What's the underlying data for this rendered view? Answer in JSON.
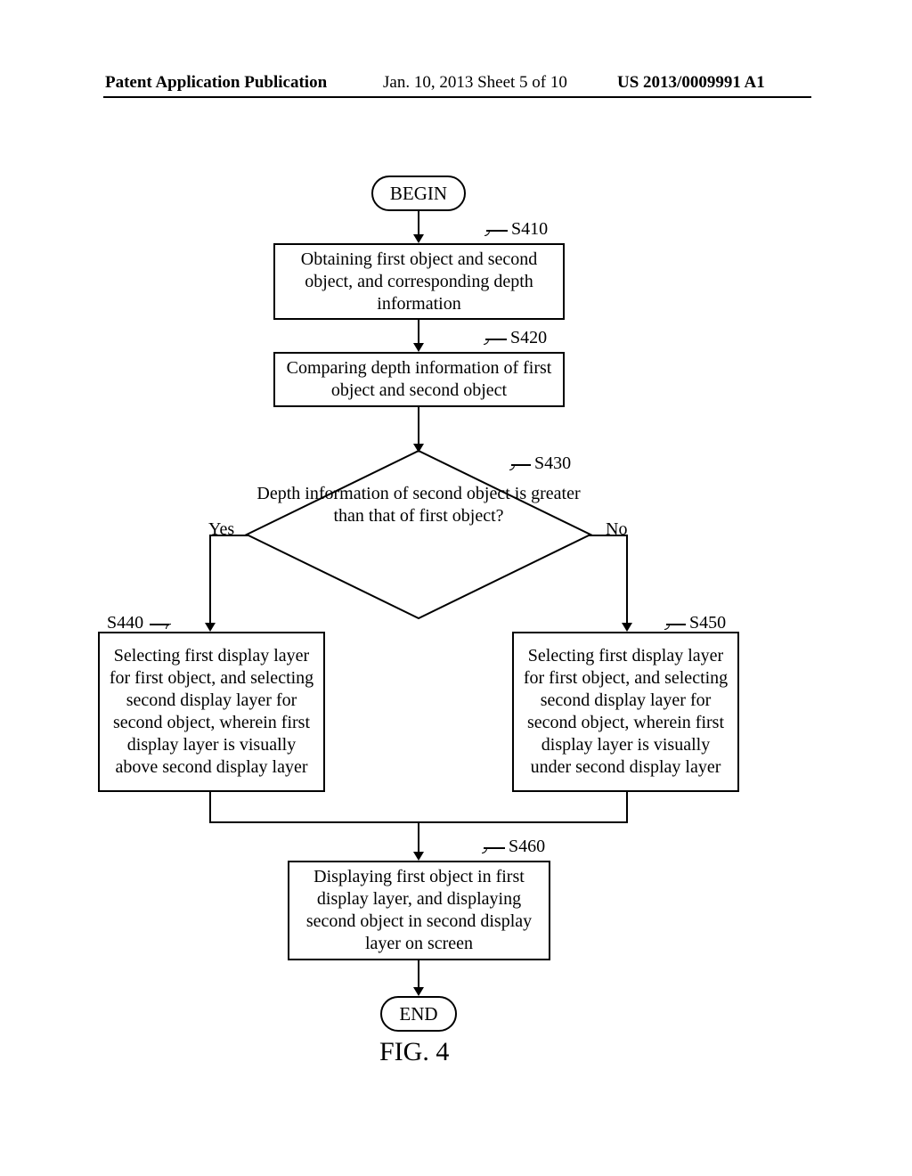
{
  "header": {
    "left": "Patent Application Publication",
    "center": "Jan. 10, 2013  Sheet 5 of 10",
    "right": "US 2013/0009991 A1"
  },
  "terminals": {
    "begin": "BEGIN",
    "end": "END"
  },
  "steps": {
    "s410": {
      "id": "S410",
      "text": "Obtaining first object and second object, and corresponding depth information"
    },
    "s420": {
      "id": "S420",
      "text": "Comparing depth information of first object and second object"
    },
    "s430": {
      "id": "S430",
      "text": "Depth information of second object is greater than that of first object?",
      "yes": "Yes",
      "no": "No"
    },
    "s440": {
      "id": "S440",
      "text": "Selecting first display layer for first object, and selecting second display layer for second object, wherein first display layer is visually above second display layer"
    },
    "s450": {
      "id": "S450",
      "text": "Selecting first display layer for first object, and selecting second display layer for second object, wherein first display layer is visually under second display layer"
    },
    "s460": {
      "id": "S460",
      "text": "Displaying first object in first display layer, and displaying second object in second display layer on screen"
    }
  },
  "figure_caption": "FIG. 4"
}
